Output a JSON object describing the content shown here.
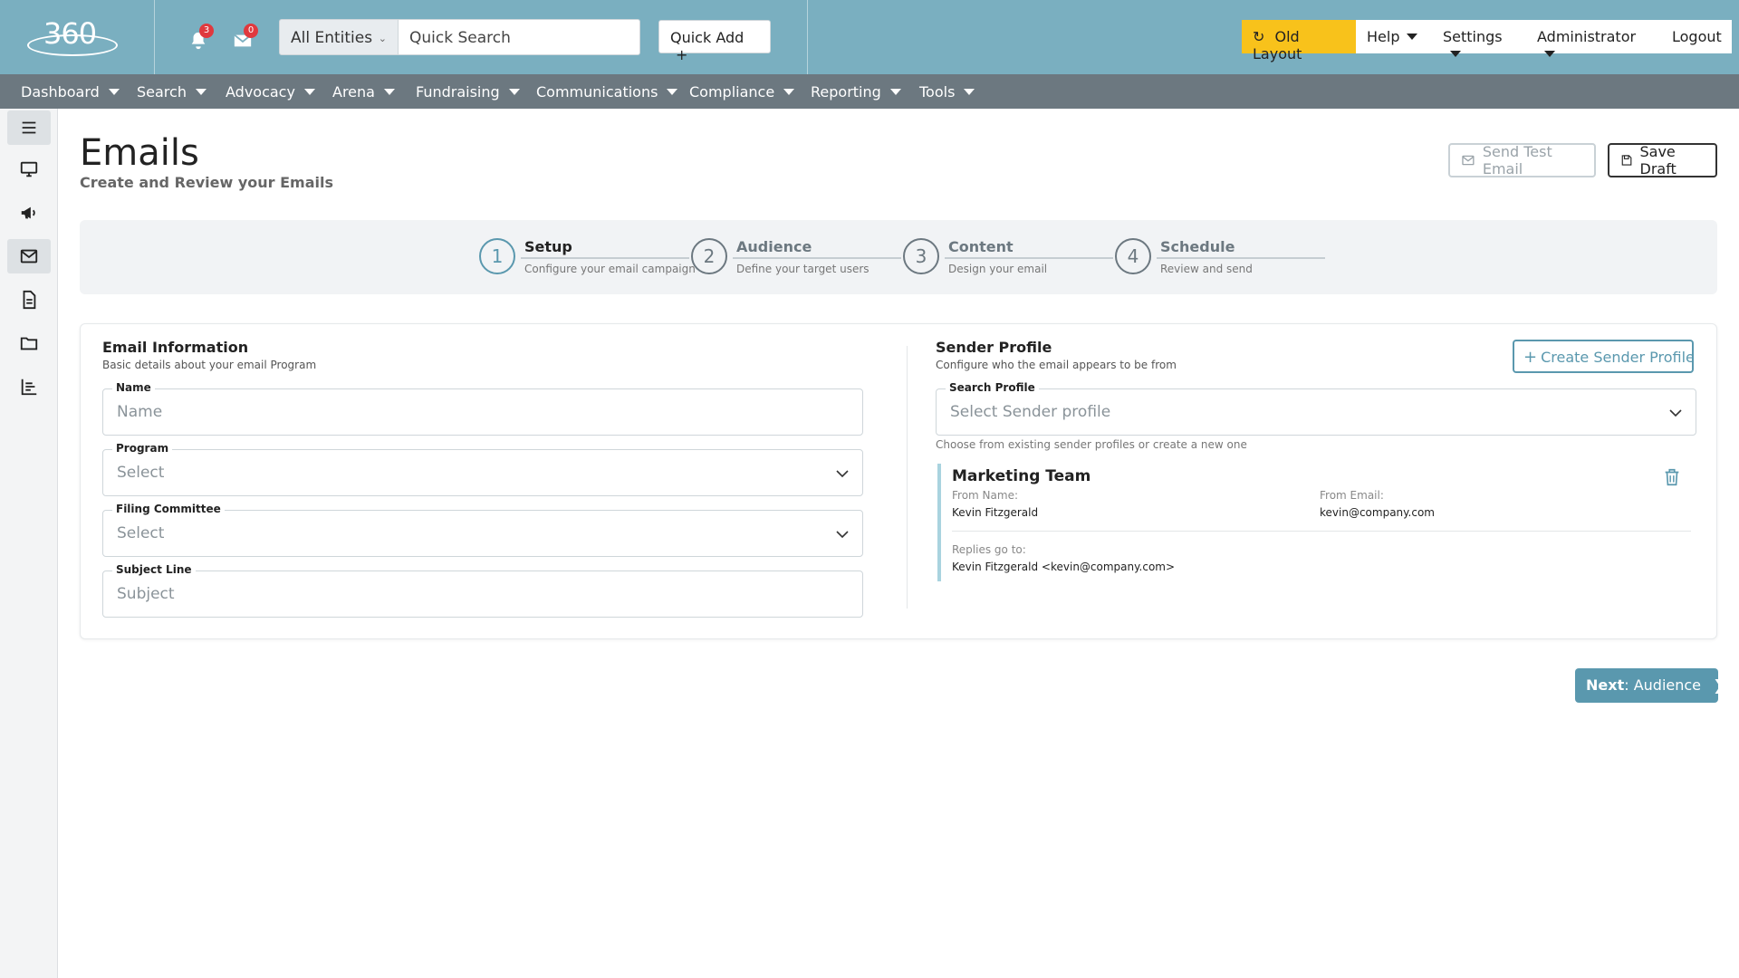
{
  "header": {
    "logo_text": "360",
    "notifications_count": "3",
    "messages_count": "0",
    "entity_select": "All Entities",
    "search_placeholder": "Quick Search",
    "quick_add": "Quick Add",
    "old_layout": "Old Layout",
    "help": "Help",
    "settings": "Settings",
    "administrator": "Administrator",
    "logout": "Logout"
  },
  "nav": [
    "Dashboard",
    "Search",
    "Advocacy",
    "Arena",
    "Fundraising",
    "Communications",
    "Compliance",
    "Reporting",
    "Tools"
  ],
  "page": {
    "title": "Emails",
    "subtitle": "Create and Review your Emails",
    "send_test": "Send Test Email",
    "save_draft": "Save Draft"
  },
  "steps": [
    {
      "number": "1",
      "title": "Setup",
      "desc": "Configure your email campaign"
    },
    {
      "number": "2",
      "title": "Audience",
      "desc": "Define your target users"
    },
    {
      "number": "3",
      "title": "Content",
      "desc": "Design your email"
    },
    {
      "number": "4",
      "title": "Schedule",
      "desc": "Review and send"
    }
  ],
  "email_info": {
    "title": "Email Information",
    "subtitle": "Basic details about your email Program",
    "name_label": "Name",
    "name_placeholder": "Name",
    "program_label": "Program",
    "program_value": "Select",
    "committee_label": "Filing Committee",
    "committee_value": "Select",
    "subject_label": "Subject Line",
    "subject_placeholder": "Subject"
  },
  "sender": {
    "title": "Sender Profile",
    "subtitle": "Configure who the email appears to be from",
    "create_button": "Create Sender Profile",
    "search_label": "Search Profile",
    "search_placeholder": "Select Sender profile",
    "helper": "Choose from existing sender profiles or create a new one",
    "profile": {
      "name": "Marketing Team",
      "from_name_label": "From Name:",
      "from_name": "Kevin Fitzgerald",
      "from_email_label": "From Email:",
      "from_email": "kevin@company.com",
      "replies_label": "Replies go to:",
      "replies": "Kevin Fitzgerald <kevin@company.com>"
    }
  },
  "next": {
    "bold": "Next",
    "rest": ": Audience"
  },
  "colors": {
    "header": "#7aafc0",
    "nav": "#6c7880",
    "accent": "#5a98ae",
    "old_layout": "#f8c21b"
  }
}
